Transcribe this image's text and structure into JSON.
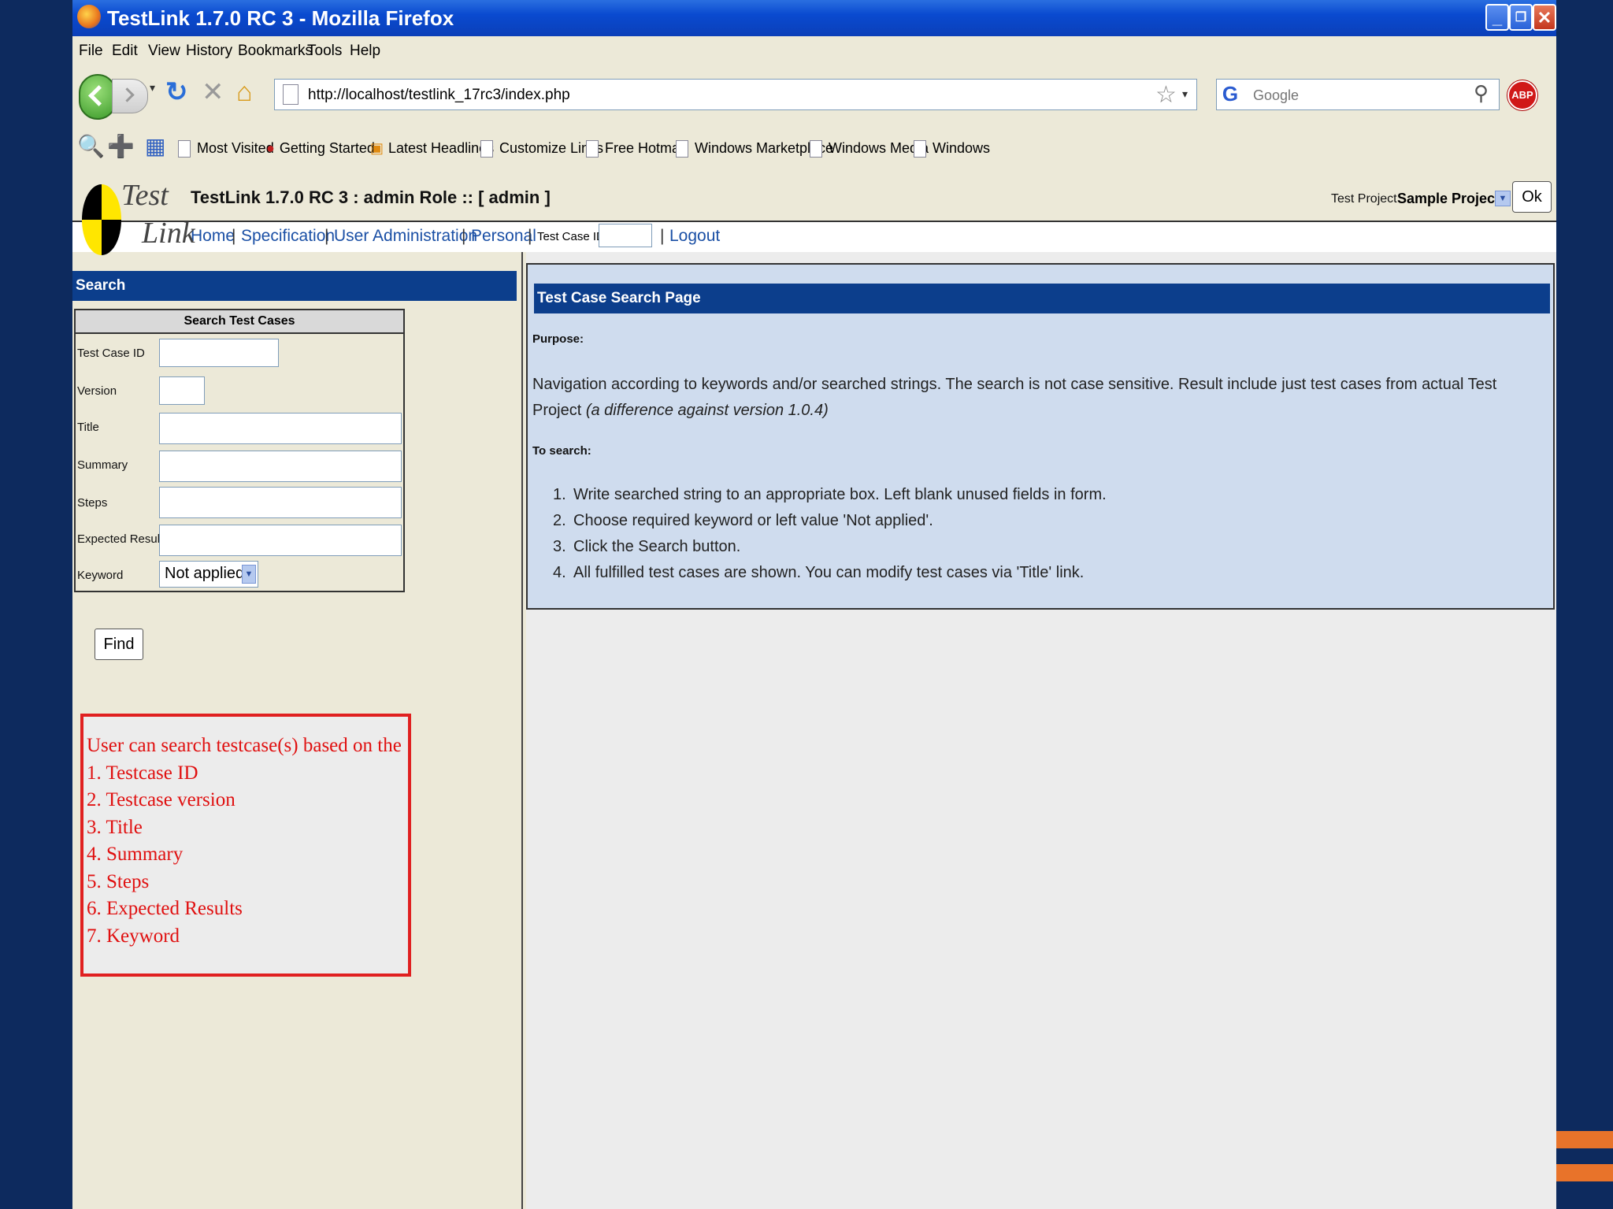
{
  "window": {
    "title": "TestLink 1.7.0 RC 3 - Mozilla Firefox"
  },
  "menu": [
    "File",
    "Edit",
    "View",
    "History",
    "Bookmarks",
    "Tools",
    "Help"
  ],
  "address": {
    "url": "http://localhost/testlink_17rc3/index.php"
  },
  "search_bar": {
    "placeholder": "Google"
  },
  "abp_label": "ABP",
  "bookmarks": [
    "Most Visited",
    "Getting Started",
    "Latest Headlines",
    "Customize Links",
    "Free Hotmail",
    "Windows Marketplace",
    "Windows Media",
    "Windows"
  ],
  "testlink": {
    "logo_top": "Test",
    "logo_bottom": "Link",
    "header_title": "TestLink 1.7.0 RC 3 : admin Role :: [ admin ]",
    "project_label": "Test Project",
    "project_value": "Sample Project",
    "ok_label": "Ok",
    "nav": {
      "home": "Home",
      "specification": "Specification",
      "user_admin": "User Administration",
      "personal": "Personal",
      "test_case_id_label": "Test Case ID:",
      "logout": "Logout"
    }
  },
  "left": {
    "header": "Search",
    "box_caption": "Search Test Cases",
    "fields": {
      "test_case_id": "Test Case ID",
      "version": "Version",
      "title": "Title",
      "summary": "Summary",
      "steps": "Steps",
      "expected_results": "Expected Results",
      "keyword": "Keyword"
    },
    "keyword_value": "Not applied",
    "find_label": "Find"
  },
  "note": {
    "lines": [
      "User can search testcase(s) based on the",
      "1. Testcase ID",
      "2. Testcase version",
      "3. Title",
      "4. Summary",
      "5. Steps",
      "6. Expected Results",
      "7. Keyword"
    ]
  },
  "right": {
    "title": "Test Case Search Page",
    "purpose_label": "Purpose:",
    "purpose_text": "Navigation according to keywords and/or searched strings. The search is not case sensitive. Result include just test cases from actual Test Project",
    "purpose_italic": "(a difference against version 1.0.4)",
    "to_search_label": "To search:",
    "steps": [
      {
        "num": "1.",
        "text": "Write searched string to an appropriate box. Left blank unused fields in form."
      },
      {
        "num": "2.",
        "text": "Choose required keyword or left value 'Not applied'."
      },
      {
        "num": "3.",
        "text": "Click the Search button."
      },
      {
        "num": "4.",
        "text": "All fulfilled test cases are shown. You can modify test cases via 'Title' link."
      }
    ]
  },
  "colors": {
    "slide_bg": "#0d2a5e",
    "accent_orange": "#e8732a",
    "header_blue": "#0c3e8c",
    "note_red": "#e01010"
  }
}
